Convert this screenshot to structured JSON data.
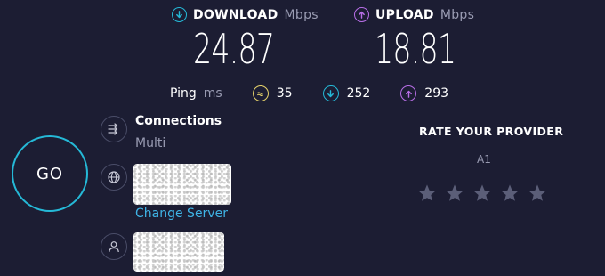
{
  "download": {
    "label": "DOWNLOAD",
    "unit": "Mbps",
    "value": "24.87",
    "color": "#25b9d7",
    "icon": "arrow-down-icon"
  },
  "upload": {
    "label": "UPLOAD",
    "unit": "Mbps",
    "value": "18.81",
    "color": "#b76ee6",
    "icon": "arrow-up-icon"
  },
  "ping": {
    "label": "Ping",
    "unit": "ms",
    "items": [
      {
        "icon": "jitter-icon",
        "value": "35",
        "color": "#e6d26b"
      },
      {
        "icon": "arrow-down-icon",
        "value": "252",
        "color": "#25b9d7"
      },
      {
        "icon": "arrow-up-icon",
        "value": "293",
        "color": "#b76ee6"
      }
    ]
  },
  "go_label": "GO",
  "connections": {
    "title": "Connections",
    "value": "Multi",
    "icon": "connections-icon"
  },
  "server": {
    "icon": "globe-icon",
    "change_label": "Change Server"
  },
  "user": {
    "icon": "user-icon"
  },
  "rate": {
    "title": "RATE YOUR PROVIDER",
    "provider": "A1",
    "stars_total": 5,
    "stars_filled": 0,
    "star_color": "#5b5e78"
  }
}
